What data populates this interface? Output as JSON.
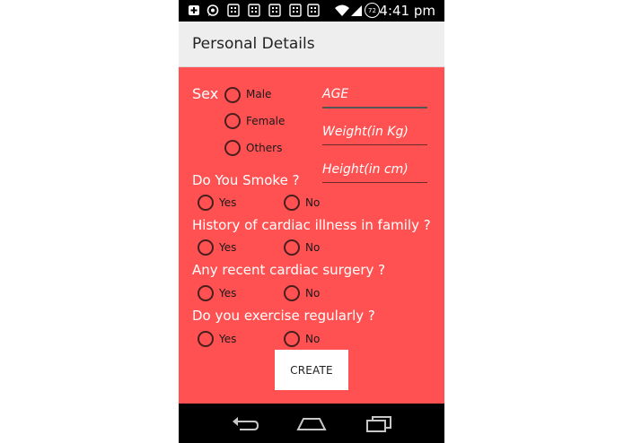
{
  "status_bar": {
    "time": "4:41 pm",
    "battery_level": "72",
    "icons": [
      "plus-icon",
      "whatsapp-icon",
      "app-icon",
      "app-icon",
      "app-icon",
      "app-icon",
      "app-icon",
      "wifi-icon",
      "signal-icon",
      "battery-icon"
    ]
  },
  "action_bar": {
    "title": "Personal Details"
  },
  "form": {
    "sex_label": "Sex",
    "sex_options": [
      "Male",
      "Female",
      "Others"
    ],
    "age_placeholder": "AGE",
    "weight_placeholder": "Weight(in Kg)",
    "height_placeholder": "Height(in cm)",
    "questions": [
      {
        "label": "Do You Smoke ?",
        "yes": "Yes",
        "no": "No"
      },
      {
        "label": "History of cardiac illness in family ?",
        "yes": "Yes",
        "no": "No"
      },
      {
        "label": "Any recent cardiac surgery ?",
        "yes": "Yes",
        "no": "No"
      },
      {
        "label": "Do you exercise regularly ?",
        "yes": "Yes",
        "no": "No"
      }
    ],
    "create_label": "CREATE"
  },
  "colors": {
    "content_bg": "#ff5151",
    "action_bar_bg": "#eeeeee",
    "status_bar_bg": "#000000"
  }
}
